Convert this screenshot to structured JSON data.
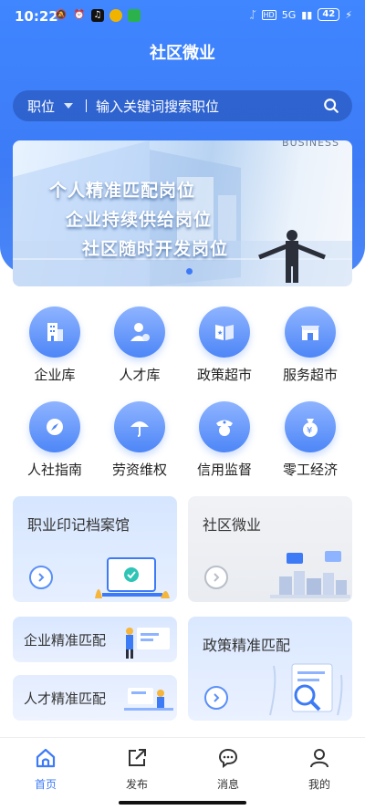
{
  "status": {
    "time": "10:22",
    "battery": "42",
    "network": "5G"
  },
  "header": {
    "title": "社区微业"
  },
  "search": {
    "category": "职位",
    "placeholder": "输入关键词搜索职位"
  },
  "banner": {
    "lines": [
      "个人精准匹配岗位",
      "企业持续供给岗位",
      "社区随时开发岗位"
    ],
    "biz_text": "BUSINESS"
  },
  "grid": [
    {
      "label": "企业库",
      "icon": "building-icon"
    },
    {
      "label": "人才库",
      "icon": "person-icon"
    },
    {
      "label": "政策超市",
      "icon": "book-icon"
    },
    {
      "label": "服务超市",
      "icon": "store-icon"
    },
    {
      "label": "人社指南",
      "icon": "compass-icon"
    },
    {
      "label": "劳资维权",
      "icon": "umbrella-icon"
    },
    {
      "label": "信用监督",
      "icon": "officer-icon"
    },
    {
      "label": "零工经济",
      "icon": "money-bag-icon"
    }
  ],
  "cards": {
    "archive": "职业印记档案馆",
    "community": "社区微业",
    "enterprise_match": "企业精准匹配",
    "talent_match": "人才精准匹配",
    "policy_match": "政策精准匹配"
  },
  "tabs": [
    {
      "label": "首页",
      "icon": "home-icon",
      "active": true
    },
    {
      "label": "发布",
      "icon": "publish-icon",
      "active": false
    },
    {
      "label": "消息",
      "icon": "message-icon",
      "active": false
    },
    {
      "label": "我的",
      "icon": "profile-icon",
      "active": false
    }
  ],
  "colors": {
    "primary": "#3d7bf6",
    "card_blue": "#dbe8ff",
    "card_gray": "#eef0f4"
  }
}
